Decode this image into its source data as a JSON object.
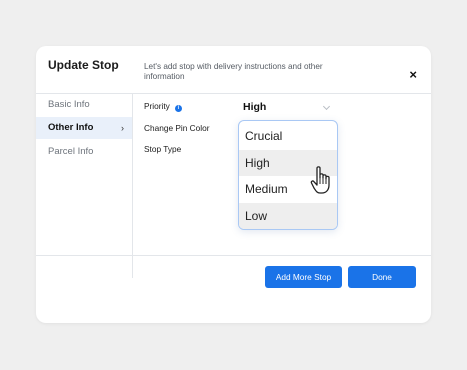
{
  "modal": {
    "title": "Update Stop",
    "subtitle": "Let's add stop with delivery instructions and other information",
    "close_label": "×"
  },
  "sidebar": {
    "items": [
      {
        "label": "Basic Info"
      },
      {
        "label": "Other Info"
      },
      {
        "label": "Parcel Info"
      }
    ],
    "active_chevron": "›"
  },
  "form": {
    "priority_label": "Priority",
    "info_glyph": "i",
    "pin_color_label": "Change Pin Color",
    "stop_type_label": "Stop Type",
    "priority_value": "High"
  },
  "dropdown": {
    "options": [
      "Crucial",
      "High",
      "Medium",
      "Low"
    ]
  },
  "footer": {
    "add_more_label": "Add More Stop",
    "done_label": "Done"
  },
  "colors": {
    "accent": "#1a73e8",
    "active_sidebar_bg": "#e9f0fa",
    "page_bg": "#efefef"
  },
  "icons": [
    "close-icon",
    "chevron-right-icon",
    "info-icon",
    "chevron-down-icon",
    "hand-pointer-icon"
  ]
}
